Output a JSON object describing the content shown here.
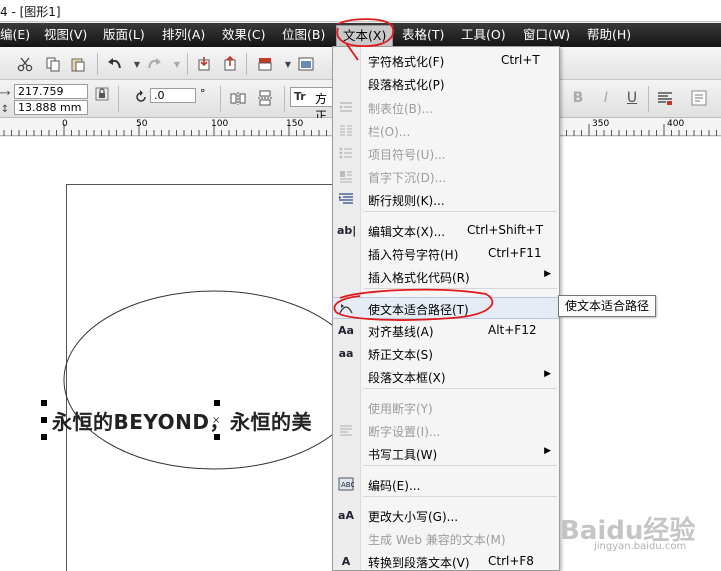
{
  "title_bar": {
    "text": "4 - [图形1]"
  },
  "menubar": {
    "items": [
      "编(E)",
      "视图(V)",
      "版面(L)",
      "排列(A)",
      "效果(C)",
      "位图(B)",
      "文本(X)",
      "表格(T)",
      "工具(O)",
      "窗口(W)",
      "帮助(H)"
    ],
    "active": "文本(X)"
  },
  "property_bar": {
    "width_value": "217.759 mm",
    "height_value": "13.888 mm",
    "rotation_value": ".0",
    "rotation_unit": "°",
    "font_prefix": "方正",
    "font_icon_label": "Tr"
  },
  "ruler": {
    "ticks": [
      "0",
      "50",
      "100",
      "150",
      "350",
      "400"
    ]
  },
  "canvas": {
    "artistic_text": "永恒的BEYOND，永恒的美"
  },
  "text_menu": {
    "items": [
      {
        "label": "字符格式化(F)",
        "shortcut": "Ctrl+T",
        "enabled": true,
        "icon": ""
      },
      {
        "label": "段落格式化(P)",
        "shortcut": "",
        "enabled": true,
        "icon": ""
      },
      {
        "label": "制表位(B)...",
        "shortcut": "",
        "enabled": false,
        "icon": "tab-stops-icon"
      },
      {
        "label": "栏(O)...",
        "shortcut": "",
        "enabled": false,
        "icon": "columns-icon"
      },
      {
        "label": "项目符号(U)...",
        "shortcut": "",
        "enabled": false,
        "icon": "bullets-icon"
      },
      {
        "label": "首字下沉(D)...",
        "shortcut": "",
        "enabled": false,
        "icon": "drop-cap-icon"
      },
      {
        "label": "断行规则(K)...",
        "shortcut": "",
        "enabled": true,
        "icon": "line-break-icon"
      },
      {
        "label": "编辑文本(X)...",
        "shortcut": "Ctrl+Shift+T",
        "enabled": true,
        "icon": "edit-text-icon",
        "icon_text": "ab|"
      },
      {
        "label": "插入符号字符(H)",
        "shortcut": "Ctrl+F11",
        "enabled": true,
        "icon": ""
      },
      {
        "label": "插入格式化代码(R)",
        "shortcut": "",
        "enabled": true,
        "icon": "",
        "submenu": true
      },
      {
        "label": "使文本适合路径(T)",
        "shortcut": "",
        "enabled": true,
        "icon": "fit-text-to-path-icon",
        "highlight": true
      },
      {
        "label": "对齐基线(A)",
        "shortcut": "Alt+F12",
        "enabled": true,
        "icon": "align-baseline-icon",
        "icon_text": "Aa"
      },
      {
        "label": "矫正文本(S)",
        "shortcut": "",
        "enabled": true,
        "icon": "straighten-text-icon",
        "icon_text": "aa"
      },
      {
        "label": "段落文本框(X)",
        "shortcut": "",
        "enabled": true,
        "icon": "",
        "submenu": true
      },
      {
        "label": "使用断字(Y)",
        "shortcut": "",
        "enabled": false,
        "icon": ""
      },
      {
        "label": "断字设置(I)...",
        "shortcut": "",
        "enabled": false,
        "icon": "hyphenation-icon"
      },
      {
        "label": "书写工具(W)",
        "shortcut": "",
        "enabled": true,
        "icon": "",
        "submenu": true
      },
      {
        "label": "编码(E)...",
        "shortcut": "",
        "enabled": true,
        "icon": "encoding-icon"
      },
      {
        "label": "更改大小写(G)...",
        "shortcut": "",
        "enabled": true,
        "icon": "change-case-icon",
        "icon_text": "aA"
      },
      {
        "label": "生成 Web 兼容的文本(M)",
        "shortcut": "",
        "enabled": false,
        "icon": ""
      },
      {
        "label": "转换到段落文本(V)",
        "shortcut": "Ctrl+F8",
        "enabled": true,
        "icon": "convert-paragraph-icon",
        "icon_text": "A"
      }
    ]
  },
  "tooltip": {
    "text": "使文本适合路径"
  },
  "watermark": {
    "brand": "Baidu经验",
    "url": "jingyan.baidu.com"
  },
  "colors": {
    "annotation_red": "#e0191b",
    "menubar_bg": "#1e1e1e",
    "highlight_bg": "#e6ecf5"
  }
}
